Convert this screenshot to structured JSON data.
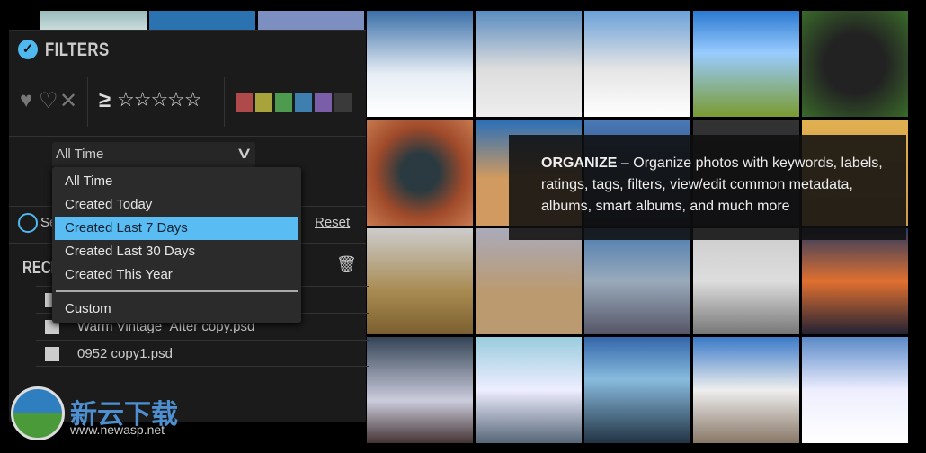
{
  "filters": {
    "title": "FILTERS",
    "rating_prefix": "≥",
    "stars": "☆☆☆☆☆",
    "colors": [
      "#b04a4a",
      "#a8a33a",
      "#4e9a4e",
      "#3f7fb0",
      "#7a5ea8",
      "#3a3a3a"
    ],
    "date_select": {
      "value": "All Time",
      "options": [
        "All Time",
        "Created Today",
        "Created Last 7 Days",
        "Created Last 30 Days",
        "Created This Year",
        "Custom"
      ],
      "highlighted": "Created Last 7 Days"
    },
    "search_label_partial": "Se",
    "reset_label": "Reset"
  },
  "recent": {
    "title_partial": "RECE",
    "files": [
      "Warm Vintage_After copy.psd",
      "0952 copy1.psd"
    ]
  },
  "overlay": {
    "heading": "ORGANIZE",
    "text": " – Organize photos with keywords, labels, ratings, tags, filters, view/edit common metadata, albums, smart albums, and much more"
  },
  "watermark": {
    "name": "新云下载",
    "url": "www.newasp.net"
  },
  "accent": "#59bdf3"
}
